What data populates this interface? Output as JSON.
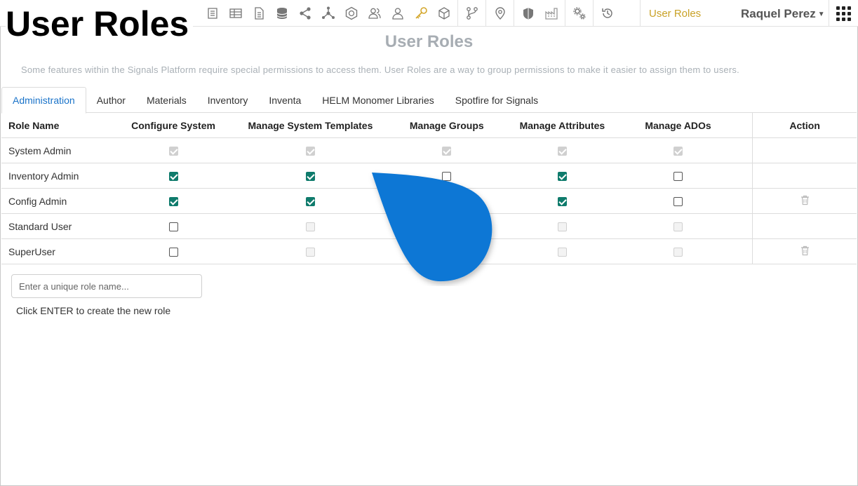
{
  "overlay_title": "User Roles",
  "toolbar": {
    "icons": [
      "list-icon",
      "table-icon",
      "document-icon",
      "database-icon",
      "share-icon",
      "network-icon",
      "hexagon-badge-icon",
      "group-icon",
      "person-icon",
      "key-icon",
      "cube-icon",
      "workflow-icon",
      "location-pin-icon",
      "shield-icon",
      "factory-icon",
      "settings-gears-icon",
      "history-icon"
    ],
    "current_page": "User Roles",
    "user_name": "Raquel Perez",
    "accent_color": "#c9a227"
  },
  "header": {
    "title": "User Roles",
    "description": "Some features within the Signals Platform require special permissions to access them. User Roles are a way to group permissions to make it easier to assign them to users."
  },
  "tabs": [
    "Administration",
    "Author",
    "Materials",
    "Inventory",
    "Inventa",
    "HELM Monomer Libraries",
    "Spotfire for Signals"
  ],
  "active_tab": "Administration",
  "table": {
    "columns": [
      "Role Name",
      "Configure System",
      "Manage System Templates",
      "Manage Groups",
      "Manage Attributes",
      "Manage ADOs",
      "Action"
    ],
    "rows": [
      {
        "name": "System Admin",
        "perms": [
          "checked-disabled",
          "checked-disabled",
          "checked-disabled",
          "checked-disabled",
          "checked-disabled"
        ],
        "deletable": false
      },
      {
        "name": "Inventory Admin",
        "perms": [
          "checked",
          "checked",
          "unchecked",
          "checked",
          "unchecked"
        ],
        "deletable": false
      },
      {
        "name": "Config Admin",
        "perms": [
          "checked",
          "checked",
          "hidden",
          "checked",
          "unchecked"
        ],
        "deletable": true
      },
      {
        "name": "Standard User",
        "perms": [
          "unchecked",
          "unchecked-disabled",
          "hidden",
          "unchecked-disabled",
          "unchecked-disabled"
        ],
        "deletable": false
      },
      {
        "name": "SuperUser",
        "perms": [
          "unchecked",
          "unchecked-disabled",
          "hidden",
          "unchecked-disabled",
          "unchecked-disabled"
        ],
        "deletable": true
      }
    ]
  },
  "new_role": {
    "placeholder": "Enter a unique role name...",
    "value": "",
    "hint": "Click ENTER to create the new role"
  },
  "overlay_color": "#0a77d5"
}
